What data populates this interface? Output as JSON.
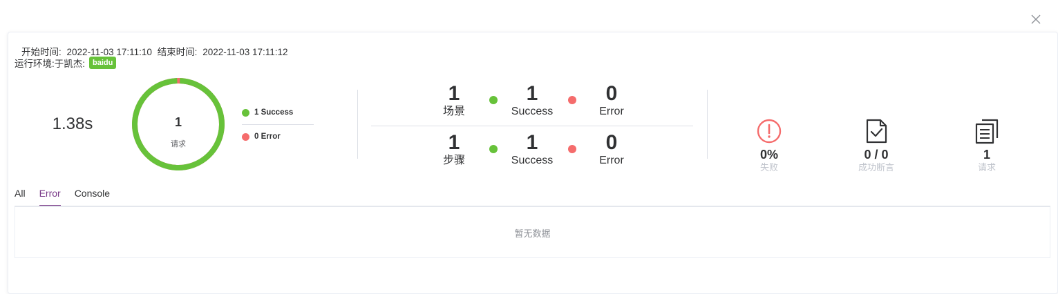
{
  "dialog": {
    "close_icon": "close-icon"
  },
  "meta": {
    "start_label": "开始时间:",
    "start_time": "2022-11-03 17:11:10",
    "end_label": "结束时间:",
    "end_time": "2022-11-03 17:11:12",
    "env_label": "运行环境:于凯杰:",
    "env_badge": "baidu"
  },
  "summary": {
    "duration": "1.38s",
    "request_count": "1",
    "request_label": "请求",
    "success_ratio": 1.0,
    "legend": [
      {
        "label": "1 Success",
        "color": "#67c23a"
      },
      {
        "label": "0 Error",
        "color": "#f56c6c"
      }
    ]
  },
  "scenario_stats": {
    "total": "1",
    "total_label": "场景",
    "success": "1",
    "success_label": "Success",
    "error": "0",
    "error_label": "Error"
  },
  "step_stats": {
    "total": "1",
    "total_label": "步骤",
    "success": "1",
    "success_label": "Success",
    "error": "0",
    "error_label": "Error"
  },
  "kpis": [
    {
      "value": "0%",
      "label": "失败",
      "icon": "alert-circle-icon",
      "color": "#f56c6c"
    },
    {
      "value": "0 / 0",
      "label": "成功断言",
      "icon": "document-check-icon",
      "color": "#303133"
    },
    {
      "value": "1",
      "label": "请求",
      "icon": "documents-copy-icon",
      "color": "#303133"
    }
  ],
  "tabs": [
    {
      "label": "All",
      "active": false
    },
    {
      "label": "Error",
      "active": true
    },
    {
      "label": "Console",
      "active": false
    }
  ],
  "empty_text": "暂无数据",
  "colors": {
    "success": "#67c23a",
    "error": "#f56c6c",
    "accent": "#783887"
  }
}
